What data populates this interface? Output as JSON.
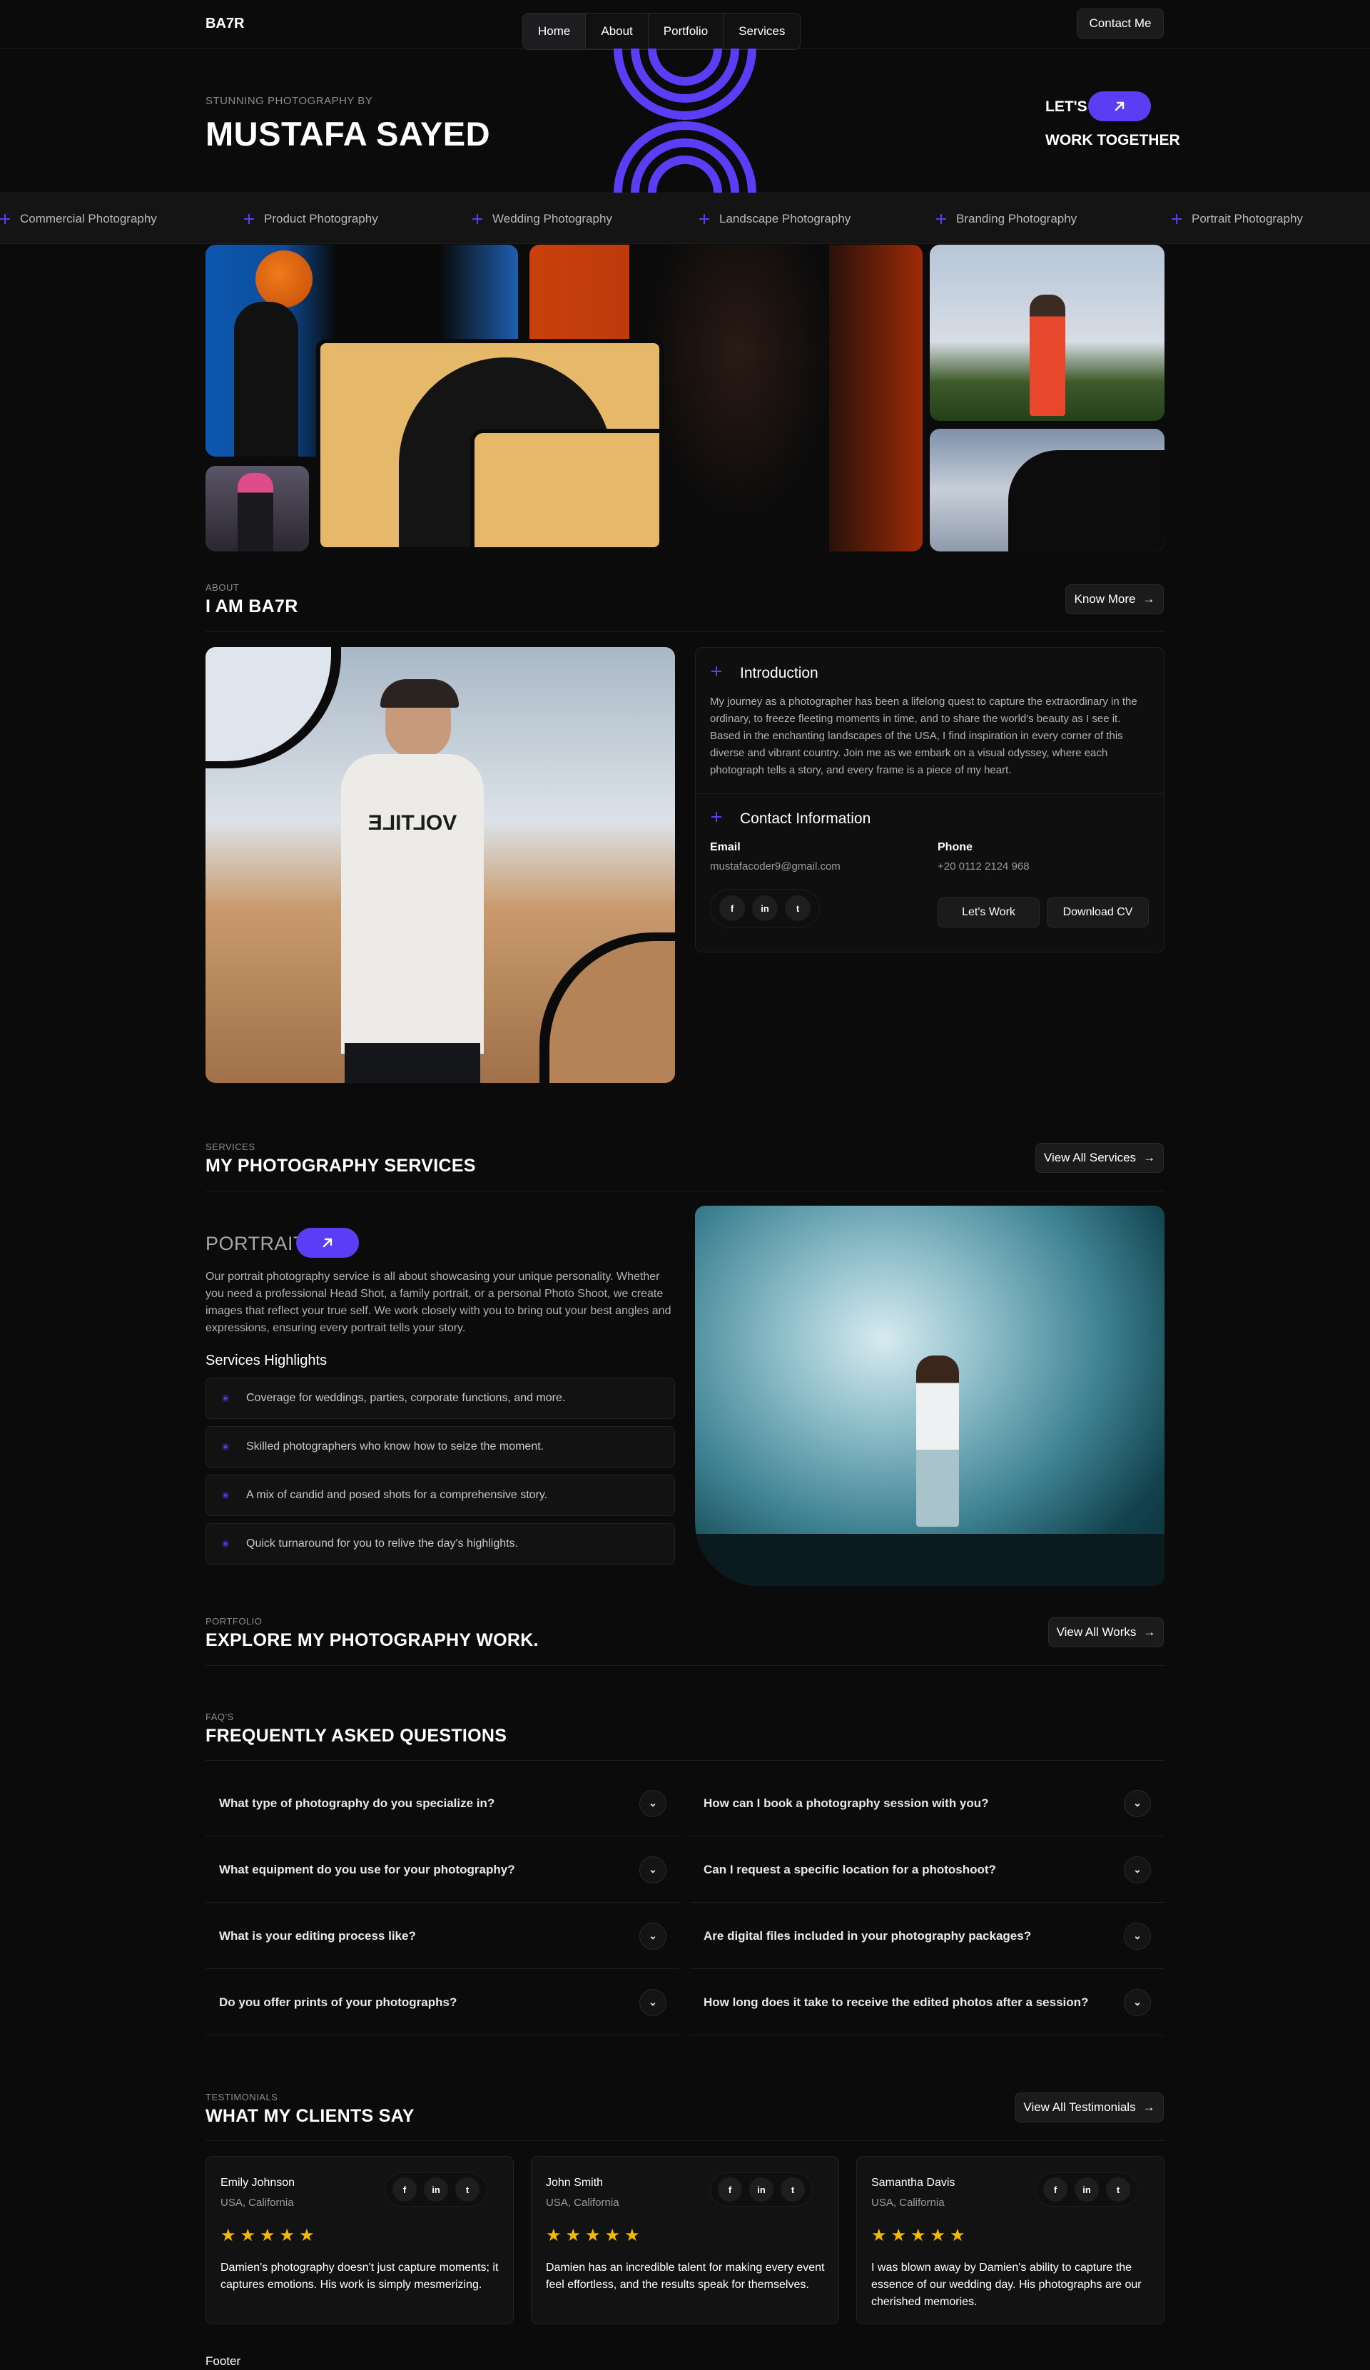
{
  "brand": "BA7R",
  "nav": [
    "Home",
    "About",
    "Portfolio",
    "Services"
  ],
  "contact_button": "Contact Me",
  "hero": {
    "kicker": "STUNNING PHOTOGRAPHY BY",
    "name": "MUSTAFA SAYED",
    "lets": "LET'S",
    "work_together": "WORK TOGETHER"
  },
  "marquee": [
    "Commercial Photography",
    "Product Photography",
    "Wedding Photography",
    "Landscape Photography",
    "Branding Photography",
    "Portrait Photography"
  ],
  "about": {
    "label": "ABOUT",
    "title": "I AM BA7R",
    "button": "Know More",
    "intro_title": "Introduction",
    "intro_text": "My journey as a photographer has been a lifelong quest to capture the extraordinary in the ordinary, to freeze fleeting moments in time, and to share the world's beauty as I see it. Based in the enchanting landscapes of the USA, I find inspiration in every corner of this diverse and vibrant country. Join me as we embark on a visual odyssey, where each photograph tells a story, and every frame is a piece of my heart.",
    "contact_title": "Contact Information",
    "email_label": "Email",
    "email": "mustafacoder9@gmail.com",
    "phone_label": "Phone",
    "phone": "+20 0112 2124 968",
    "lets_work": "Let's Work",
    "download_cv": "Download CV",
    "shirt_text": "VOLTILE"
  },
  "services": {
    "label": "SERVICES",
    "title": "MY PHOTOGRAPHY SERVICES",
    "button": "View All Services",
    "portrait_title": "PORTRAIT",
    "portrait_text": "Our portrait photography service is all about showcasing your unique personality. Whether you need a professional Head Shot, a family portrait, or a personal Photo Shoot, we create images that reflect your true self. We work closely with you to bring out your best angles and expressions, ensuring every portrait tells your story.",
    "highlights_title": "Services Highlights",
    "highlights": [
      "Coverage for weddings, parties, corporate functions, and more.",
      "Skilled photographers who know how to seize the moment.",
      "A mix of candid and posed shots for a comprehensive story.",
      "Quick turnaround for you to relive the day's highlights."
    ]
  },
  "portfolio": {
    "label": "PORTFOLIO",
    "title": "EXPLORE MY PHOTOGRAPHY WORK.",
    "button": "View All Works"
  },
  "faq": {
    "label": "FAQ'S",
    "title": "FREQUENTLY ASKED QUESTIONS",
    "left": [
      "What type of photography do you specialize in?",
      "What equipment do you use for your photography?",
      "What is your editing process like?",
      "Do you offer prints of your photographs?"
    ],
    "right": [
      "How can I book a photography session with you?",
      "Can I request a specific location for a photoshoot?",
      "Are digital files included in your photography packages?",
      "How long does it take to receive the edited photos after a session?"
    ]
  },
  "testimonials": {
    "label": "TESTIMONIALS",
    "title": "WHAT MY CLIENTS SAY",
    "button": "View All Testimonials",
    "items": [
      {
        "name": "Emily Johnson",
        "location": "USA, California",
        "stars": "★★★★★",
        "text": "Damien's photography doesn't just capture moments; it captures emotions. His work is simply mesmerizing."
      },
      {
        "name": "John Smith",
        "location": "USA, California",
        "stars": "★★★★★",
        "text": "Damien has an incredible talent for making every event feel effortless, and the results speak for themselves."
      },
      {
        "name": "Samantha Davis",
        "location": "USA, California",
        "stars": "★★★★★",
        "text": "I was blown away by Damien's ability to capture the essence of our wedding day. His photographs are our cherished memories."
      }
    ]
  },
  "footer": "Footer",
  "colors": {
    "accent": "#5b3df6",
    "bg": "#0b0b0b",
    "star": "#f5b800"
  },
  "icons": {
    "arrow": "arrow-up-right-icon",
    "facebook": "facebook-icon",
    "linkedin": "linkedin-icon",
    "twitter": "twitter-icon"
  }
}
